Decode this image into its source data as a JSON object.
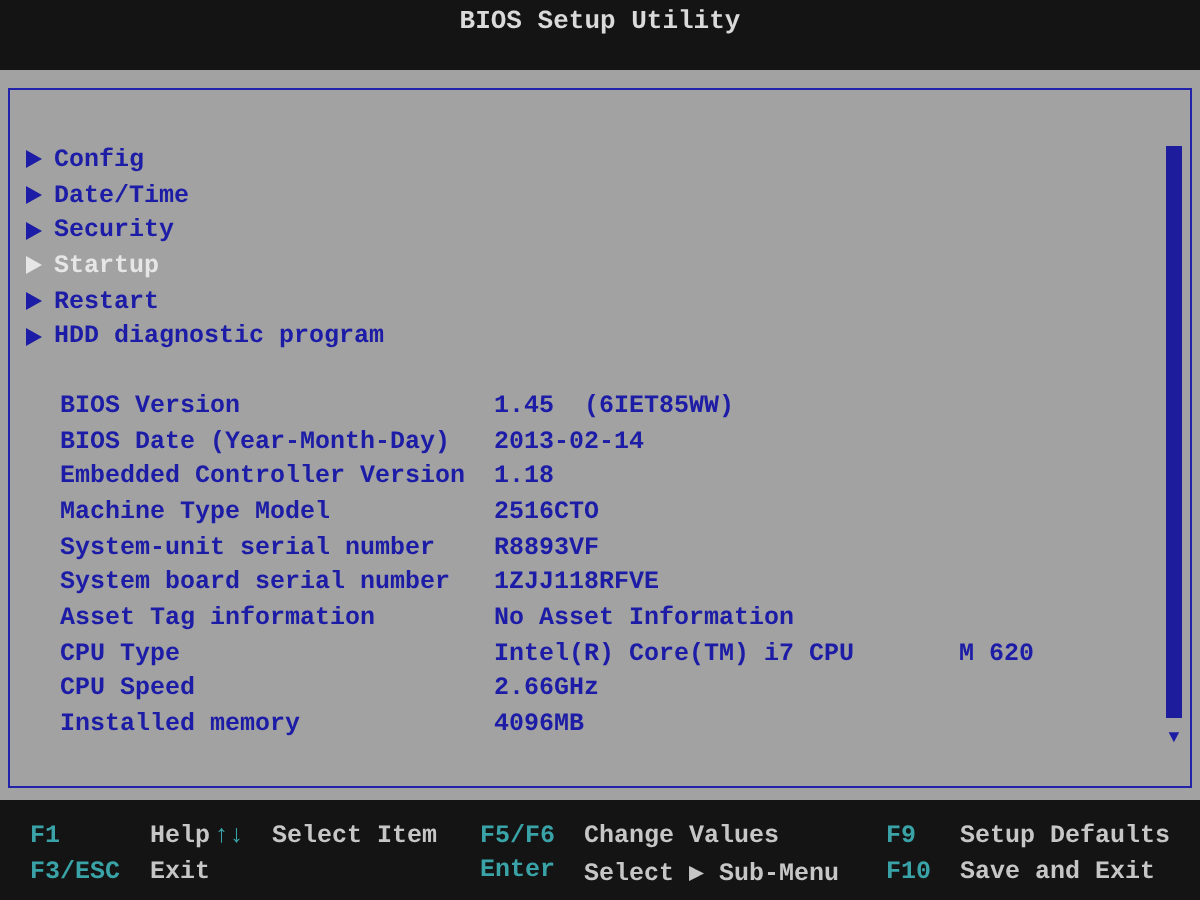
{
  "window": {
    "title": "BIOS Setup Utility"
  },
  "menu": [
    {
      "label": "Config",
      "selected": false
    },
    {
      "label": "Date/Time",
      "selected": false
    },
    {
      "label": "Security",
      "selected": false
    },
    {
      "label": "Startup",
      "selected": true
    },
    {
      "label": "Restart",
      "selected": false
    },
    {
      "label": "HDD diagnostic program",
      "selected": false
    }
  ],
  "info": [
    {
      "label": "BIOS Version",
      "value": "1.45  (6IET85WW)"
    },
    {
      "label": "BIOS Date (Year-Month-Day)",
      "value": "2013-02-14"
    },
    {
      "label": "Embedded Controller Version",
      "value": "1.18"
    },
    {
      "label": "Machine Type Model",
      "value": "2516CTO"
    },
    {
      "label": "System-unit serial number",
      "value": "R8893VF"
    },
    {
      "label": "System board serial number",
      "value": "1ZJJ118RFVE"
    },
    {
      "label": "Asset Tag information",
      "value": "No Asset Information"
    },
    {
      "label": "CPU Type",
      "value": "Intel(R) Core(TM) i7 CPU       M 620"
    },
    {
      "label": "CPU Speed",
      "value": "2.66GHz"
    },
    {
      "label": "Installed memory",
      "value": "4096MB"
    }
  ],
  "scrollbar": {
    "down_arrow": "▼"
  },
  "footer": [
    [
      [
        {
          "kind": "key",
          "text": "F1"
        },
        {
          "kind": "action",
          "text": "Help"
        },
        {
          "kind": "key",
          "text": "↑↓"
        },
        {
          "kind": "action",
          "text": "Select Item"
        }
      ],
      [
        {
          "kind": "key",
          "text": "F5/F6"
        },
        {
          "kind": "action",
          "text": "Change Values"
        }
      ],
      [
        {
          "kind": "key",
          "text": "F9"
        },
        {
          "kind": "action",
          "text": "Setup Defaults"
        }
      ]
    ],
    [
      [
        {
          "kind": "key",
          "text": "F3/ESC"
        },
        {
          "kind": "action",
          "text": "Exit"
        }
      ],
      [
        {
          "kind": "key",
          "text": "Enter"
        },
        {
          "kind": "action",
          "text": "Select ▶ Sub-Menu"
        }
      ],
      [
        {
          "kind": "key",
          "text": "F10"
        },
        {
          "kind": "action",
          "text": "Save and Exit"
        }
      ]
    ]
  ]
}
